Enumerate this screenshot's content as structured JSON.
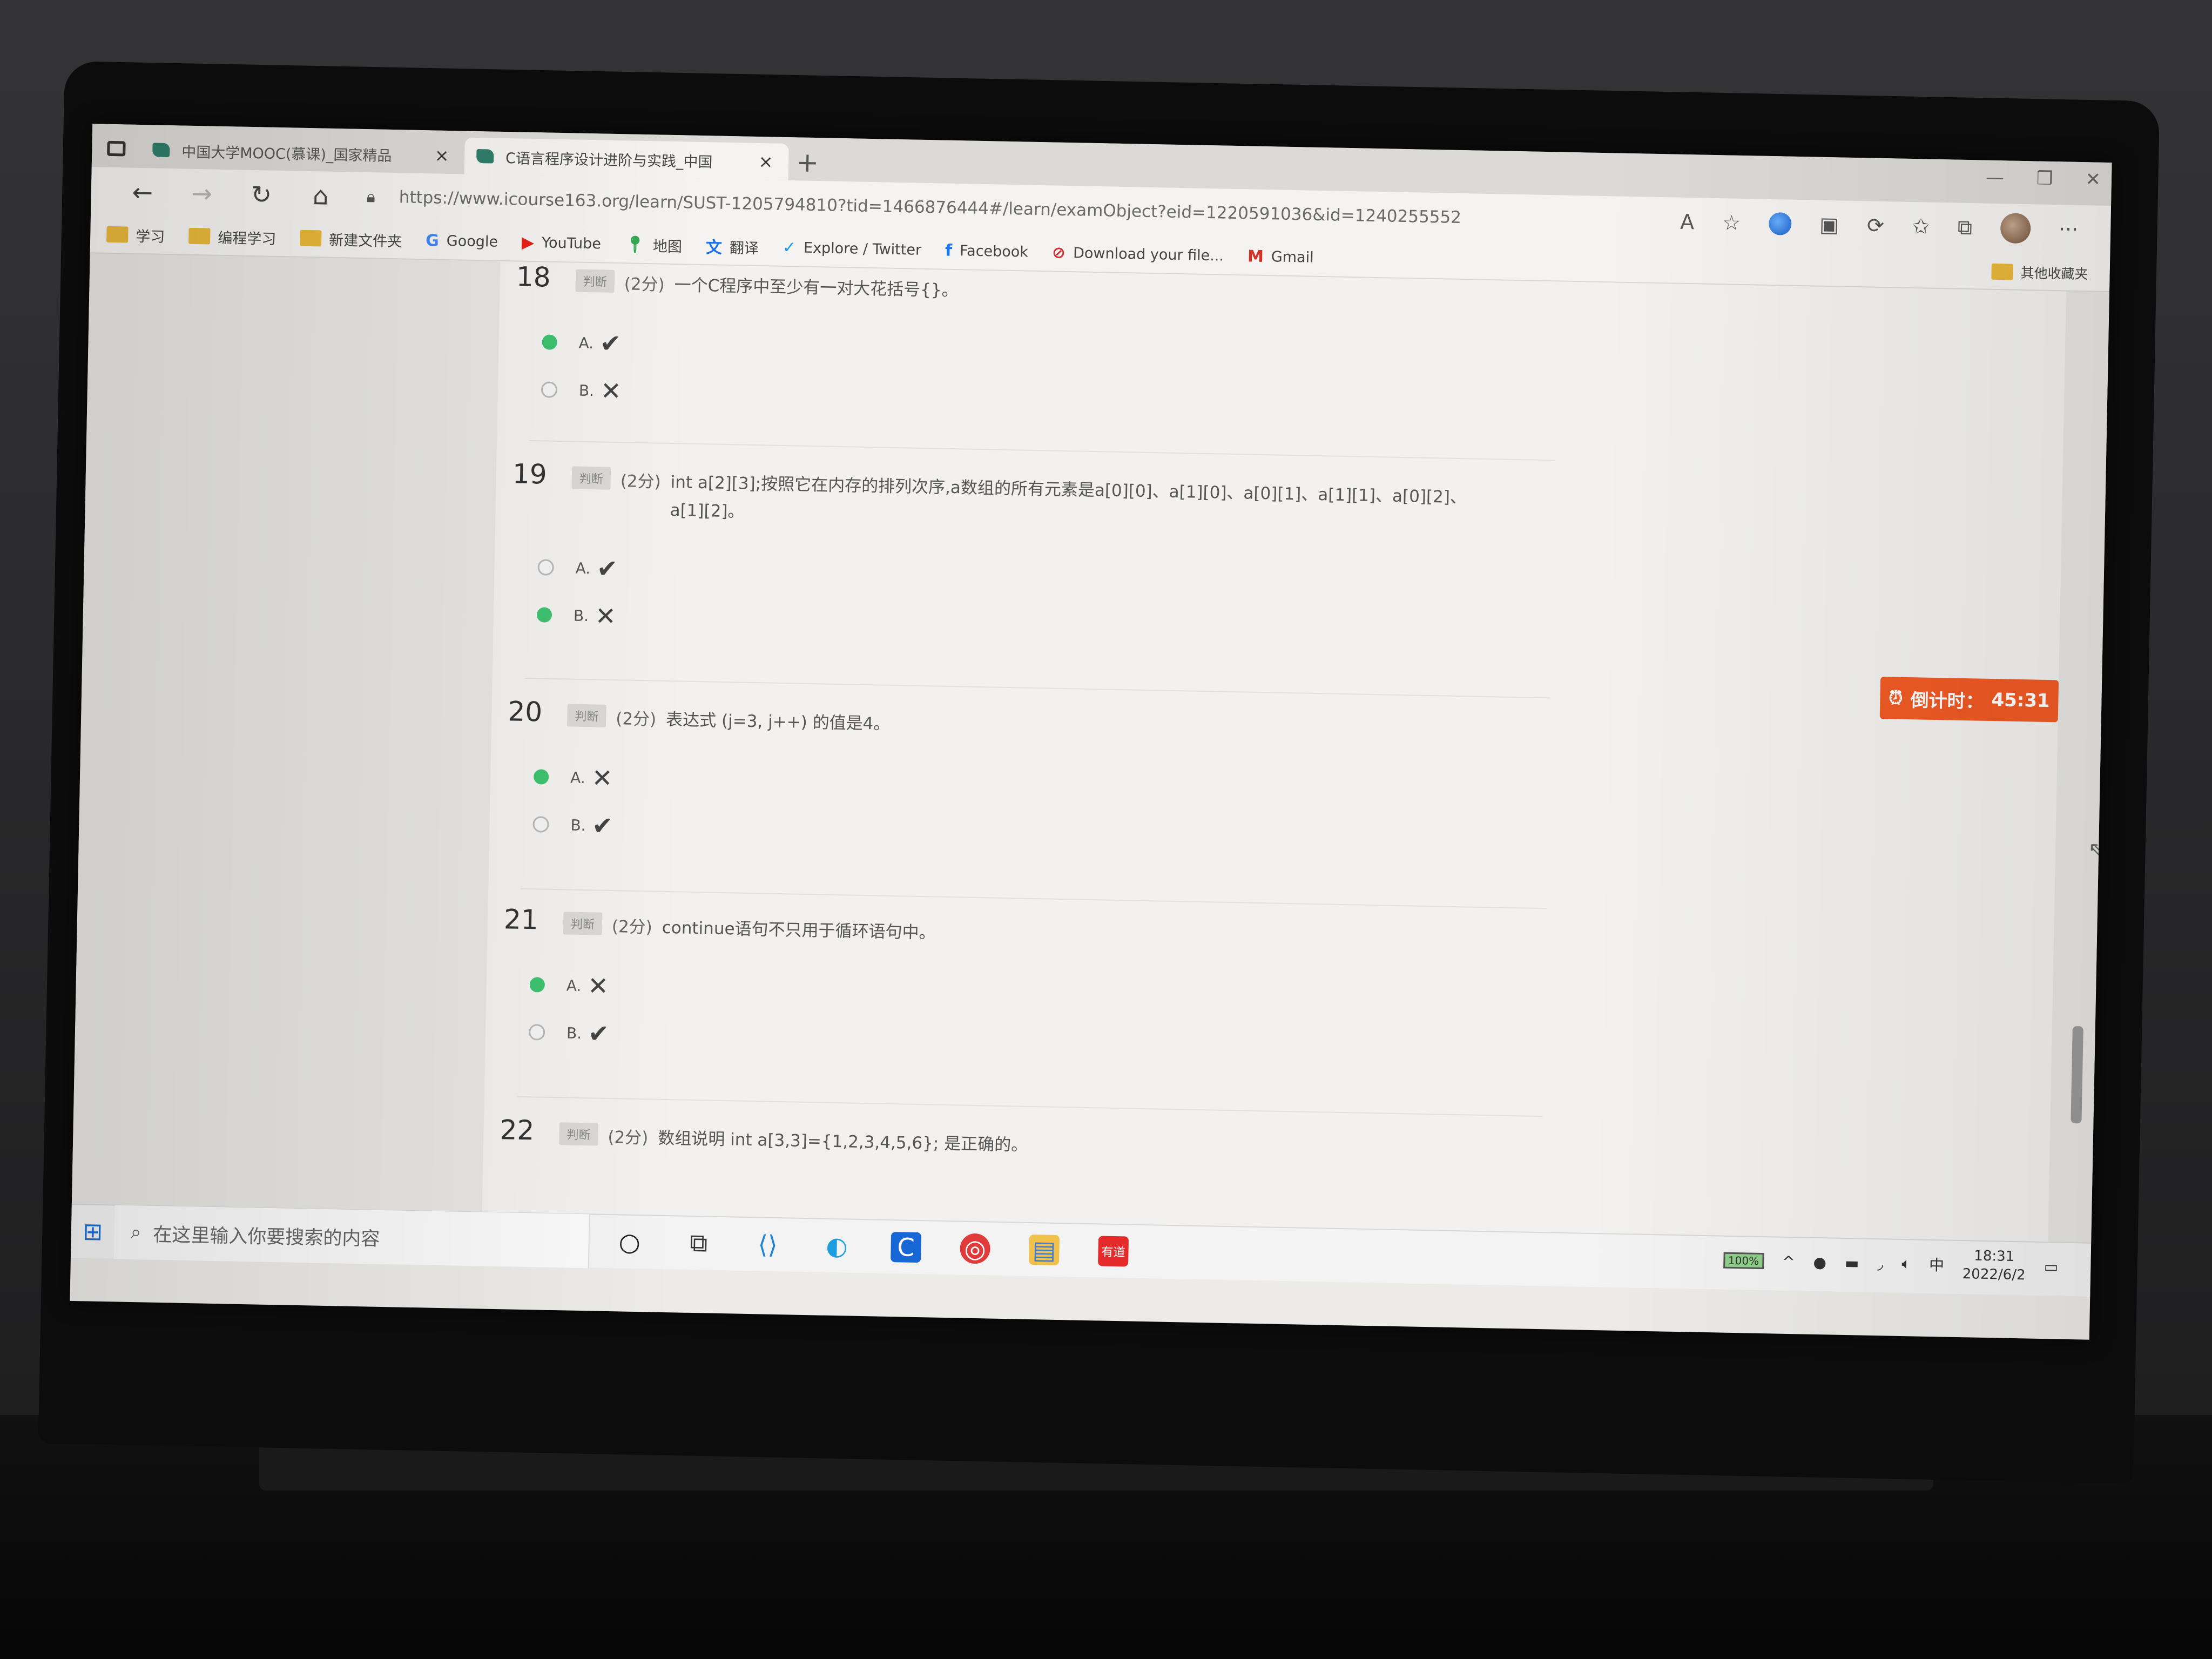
{
  "browser": {
    "tabs": [
      {
        "title": "中国大学MOOC(慕课)_国家精品",
        "active": false
      },
      {
        "title": "C语言程序设计进阶与实践_中国",
        "active": true
      }
    ],
    "url": "https://www.icourse163.org/learn/SUST-1205794810?tid=1466876444#/learn/examObject?eid=1220591036&id=1240255552",
    "bookmarks": [
      "学习",
      "编程学习",
      "新建文件夹",
      "Google",
      "YouTube",
      "地图",
      "翻译",
      "Explore / Twitter",
      "Facebook",
      "Download your file...",
      "Gmail"
    ],
    "other_bookmarks": "其他收藏夹"
  },
  "exam": {
    "timer_label": "倒计时：",
    "timer_value": "45:31",
    "questions": [
      {
        "number": "18",
        "type": "判断",
        "score": "(2分)",
        "text": "一个C程序中至少有一对大花括号{}。",
        "options": [
          {
            "letter": "A.",
            "mark": "✔",
            "selected": true
          },
          {
            "letter": "B.",
            "mark": "✕",
            "selected": false
          }
        ]
      },
      {
        "number": "19",
        "type": "判断",
        "score": "(2分)",
        "text": "int a[2][3];按照它在内存的排列次序,a数组的所有元素是a[0][0]、a[1][0]、a[0][1]、a[1][1]、a[0][2]、a[1][2]。",
        "options": [
          {
            "letter": "A.",
            "mark": "✔",
            "selected": false
          },
          {
            "letter": "B.",
            "mark": "✕",
            "selected": true
          }
        ]
      },
      {
        "number": "20",
        "type": "判断",
        "score": "(2分)",
        "text": "表达式 (j=3, j++) 的值是4。",
        "options": [
          {
            "letter": "A.",
            "mark": "✕",
            "selected": true
          },
          {
            "letter": "B.",
            "mark": "✔",
            "selected": false
          }
        ]
      },
      {
        "number": "21",
        "type": "判断",
        "score": "(2分)",
        "text": "continue语句不只用于循环语句中。",
        "options": [
          {
            "letter": "A.",
            "mark": "✕",
            "selected": true
          },
          {
            "letter": "B.",
            "mark": "✔",
            "selected": false
          }
        ]
      },
      {
        "number": "22",
        "type": "判断",
        "score": "(2分)",
        "text": "数组说明 int a[3,3]={1,2,3,4,5,6}; 是正确的。",
        "options": []
      }
    ]
  },
  "taskbar": {
    "search_placeholder": "在这里输入你要搜索的内容",
    "battery": "100%",
    "ime": "中",
    "time": "18:31",
    "date": "2022/6/2"
  }
}
